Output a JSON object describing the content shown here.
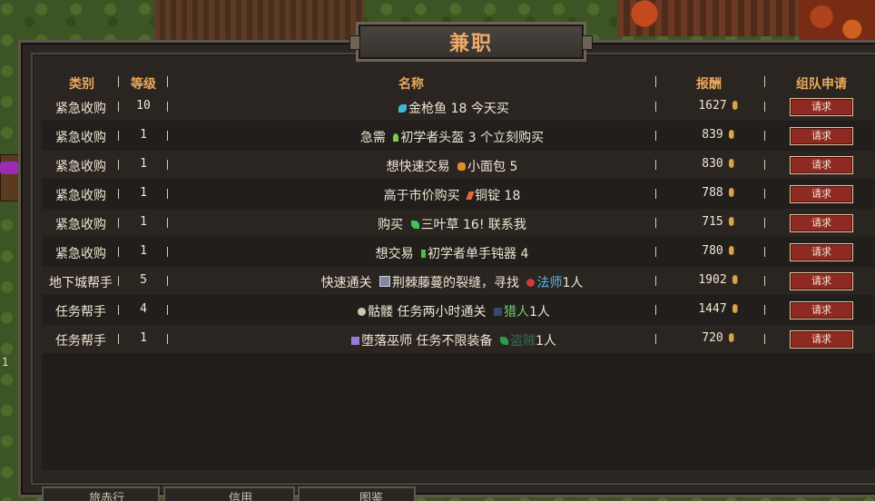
{
  "window": {
    "title": "兼职"
  },
  "columns": {
    "category": "类别",
    "level": "等级",
    "name": "名称",
    "reward": "报酬",
    "apply": "组队申请"
  },
  "rows": [
    {
      "category": "紧急收购",
      "level": "10",
      "pre": "",
      "icon": "fish-icon",
      "item": "金枪鱼",
      "post": " 18 今天买",
      "extra_icon": "",
      "extra_class": "",
      "extra_count": "",
      "reward": "1627",
      "button": "请求"
    },
    {
      "category": "紧急收购",
      "level": "1",
      "pre": "急需 ",
      "icon": "helmet-icon",
      "item": "初学者头盔",
      "post": " 3 个立刻购买",
      "extra_icon": "",
      "extra_class": "",
      "extra_count": "",
      "reward": "839",
      "button": "请求"
    },
    {
      "category": "紧急收购",
      "level": "1",
      "pre": "想快速交易 ",
      "icon": "bread-icon",
      "item": "小面包",
      "post": " 5",
      "extra_icon": "",
      "extra_class": "",
      "extra_count": "",
      "reward": "830",
      "button": "请求"
    },
    {
      "category": "紧急收购",
      "level": "1",
      "pre": "高于市价购买 ",
      "icon": "ingot-icon",
      "item": "铜锭",
      "post": " 18",
      "extra_icon": "",
      "extra_class": "",
      "extra_count": "",
      "reward": "788",
      "button": "请求"
    },
    {
      "category": "紧急收购",
      "level": "1",
      "pre": "购买 ",
      "icon": "herb-icon",
      "item": "三叶草",
      "post": " 16! 联系我",
      "extra_icon": "",
      "extra_class": "",
      "extra_count": "",
      "reward": "715",
      "button": "请求"
    },
    {
      "category": "紧急收购",
      "level": "1",
      "pre": "想交易 ",
      "icon": "axe-icon",
      "item": "初学者单手钝器",
      "post": " 4",
      "extra_icon": "",
      "extra_class": "",
      "extra_count": "",
      "reward": "780",
      "button": "请求"
    },
    {
      "category": "地下城帮手",
      "level": "5",
      "pre": "快速通关 ",
      "icon": "rift-icon",
      "item": "荆棘藤蔓的裂缝",
      "post": "，寻找 ",
      "extra_icon": "mage-icon",
      "extra_class": "法师",
      "extra_count": "1人",
      "reward": "1902",
      "button": "请求"
    },
    {
      "category": "任务帮手",
      "level": "4",
      "pre": "",
      "icon": "skull-icon",
      "item": "骷髅",
      "post": " 任务两小时通关 ",
      "extra_icon": "hunter-icon",
      "extra_class": "猎人",
      "extra_count": "1人",
      "reward": "1447",
      "button": "请求"
    },
    {
      "category": "任务帮手",
      "level": "1",
      "pre": "",
      "icon": "fallen-mage-icon",
      "item": "堕落巫师",
      "post": " 任务不限装备 ",
      "extra_icon": "thief-icon",
      "extra_class": "盗贼",
      "extra_count": "1人",
      "reward": "720",
      "button": "请求"
    }
  ],
  "bottom_tabs": [
    {
      "label": "旅赤行"
    },
    {
      "label": "信用"
    },
    {
      "label": "图鉴"
    }
  ],
  "side_number": "1"
}
